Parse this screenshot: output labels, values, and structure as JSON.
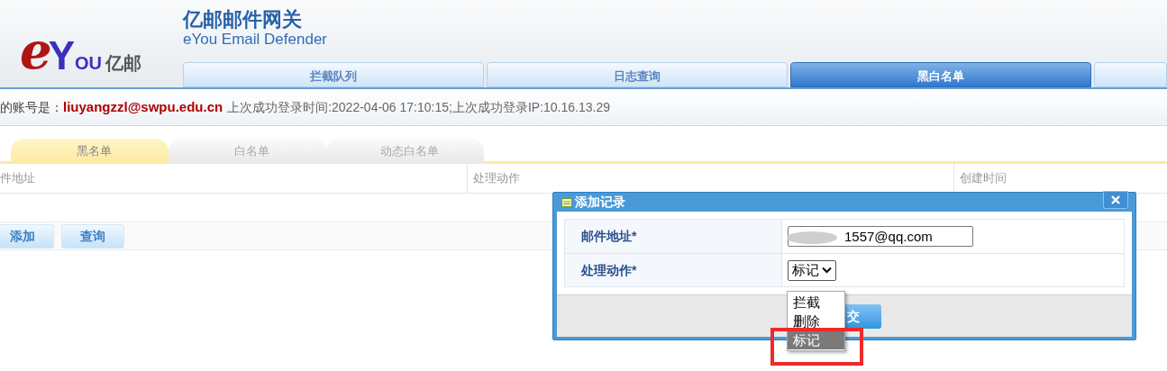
{
  "header": {
    "logo": [
      "e",
      "Y",
      "OU",
      "亿邮"
    ],
    "title": "亿邮邮件网关",
    "subtitle": "eYou Email Defender"
  },
  "tabs": [
    {
      "label": "拦截队列",
      "selected": false
    },
    {
      "label": "日志查询",
      "selected": false
    },
    {
      "label": "黑白名单",
      "selected": true
    }
  ],
  "info": {
    "prefix": "的账号是：",
    "account": "liuyangzzl@swpu.edu.cn",
    "details": "上次成功登录时间:2022-04-06 17:10:15;上次成功登录IP:10.16.13.29"
  },
  "subtabs": [
    {
      "label": "黑名单",
      "selected": true
    },
    {
      "label": "白名单",
      "selected": false
    },
    {
      "label": "动态白名单",
      "selected": false
    }
  ],
  "columns": [
    "件地址",
    "处理动作",
    "创建时间"
  ],
  "buttons": [
    "添加",
    "查询"
  ],
  "dialog": {
    "title": "添加记录",
    "fields": [
      {
        "label": "邮件地址*",
        "kind": "text",
        "value": "1557@qq.com"
      },
      {
        "label": "处理动作*",
        "kind": "select",
        "value": "标记"
      }
    ],
    "options": [
      {
        "label": "拦截",
        "selected": false
      },
      {
        "label": "删除",
        "selected": false
      },
      {
        "label": "标记",
        "selected": true
      }
    ],
    "submit": "交"
  }
}
